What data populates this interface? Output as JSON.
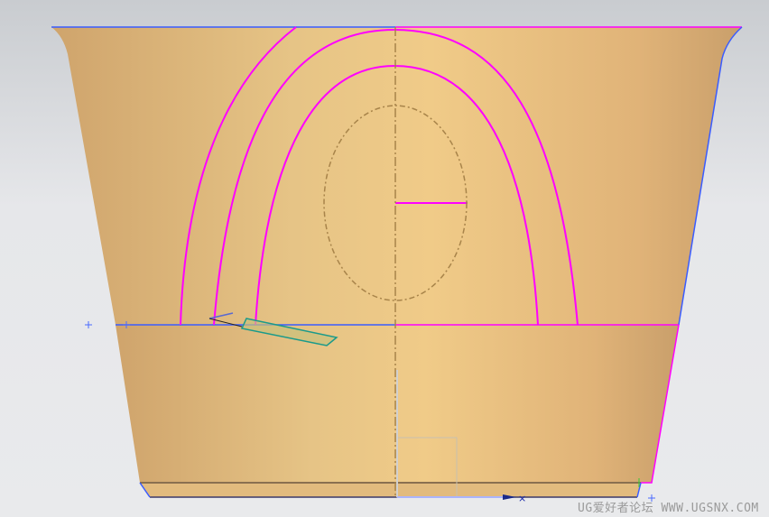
{
  "viewport": {
    "title": "3D model viewport"
  },
  "watermark": {
    "text": "UG爱好者论坛 WWW.UGSNX.COM"
  },
  "colors": {
    "body": "#e3bb7a",
    "edge_blue": "#3a5cff",
    "curve_magenta": "#ff00ff",
    "sketch_dash": "#a8844a",
    "selection_teal": "#1a9a8a"
  }
}
